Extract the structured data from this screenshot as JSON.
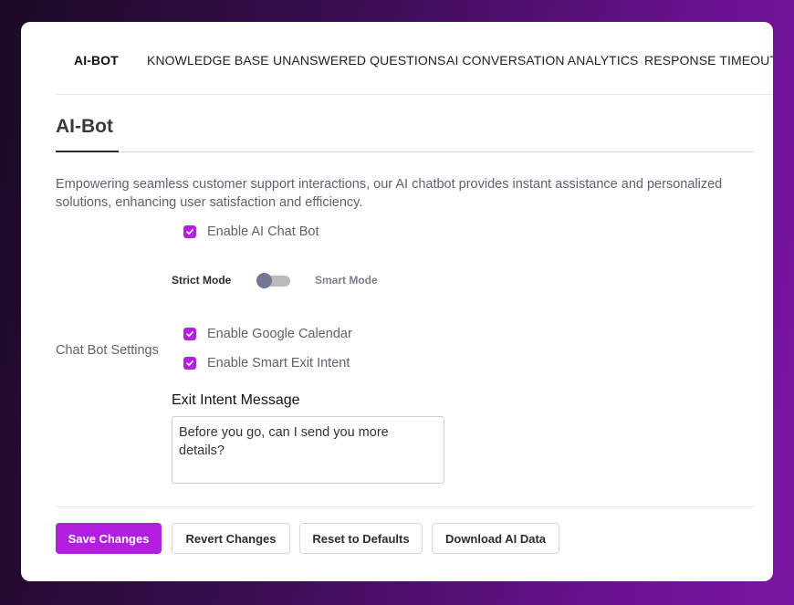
{
  "nav": {
    "items": [
      {
        "label": "AI-BOT",
        "active": true
      },
      {
        "label": "KNOWLEDGE BASE",
        "active": false
      },
      {
        "label": "UNANSWERED QUESTIONS",
        "active": false
      },
      {
        "label": "AI CONVERSATION ANALYTICS",
        "active": false
      },
      {
        "label": "RESPONSE TIMEOUT",
        "active": false
      }
    ]
  },
  "page": {
    "title": "AI-Bot",
    "description": "Empowering seamless customer support interactions, our AI chatbot provides instant assistance and personalized solutions, enhancing user satisfaction and efficiency."
  },
  "enable_bot": {
    "label": "Enable AI Chat Bot",
    "checked": true
  },
  "mode": {
    "left_label": "Strict Mode",
    "right_label": "Smart Mode",
    "value": "Strict Mode"
  },
  "settings": {
    "label": "Chat Bot Settings",
    "options": [
      {
        "label": "Enable Google Calendar",
        "checked": true
      },
      {
        "label": "Enable Smart Exit Intent",
        "checked": true
      }
    ]
  },
  "exit_intent": {
    "title": "Exit Intent Message",
    "value": "Before you go, can I send you more details?"
  },
  "actions": {
    "save": "Save Changes",
    "revert": "Revert Changes",
    "reset": "Reset to Defaults",
    "download": "Download AI Data"
  },
  "colors": {
    "accent": "#b31fe0",
    "checkbox": "#b321dd",
    "background_gradient_start": "#1a0a24",
    "background_gradient_end": "#7a16a3"
  }
}
